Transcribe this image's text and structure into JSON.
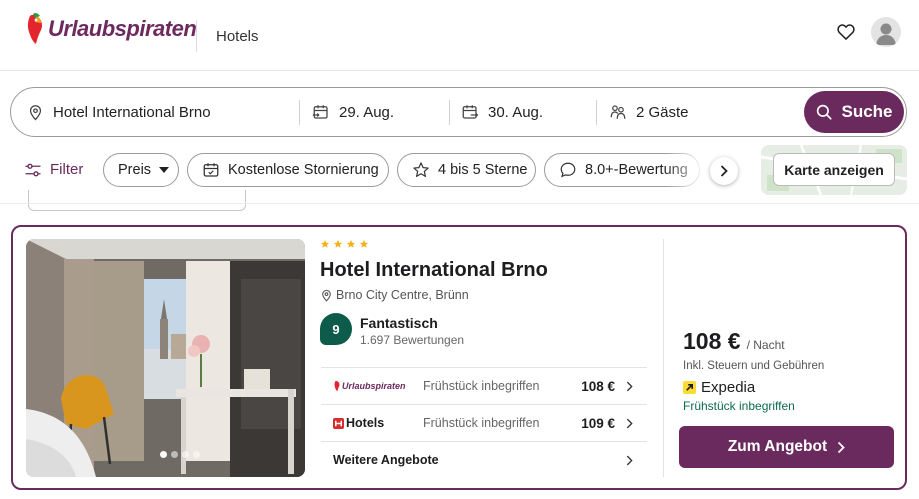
{
  "header": {
    "brand": "Urlaubspiraten",
    "section": "Hotels",
    "icons": [
      "favorites-heart-icon",
      "user-avatar-icon"
    ]
  },
  "search": {
    "destination": "Hotel International Brno",
    "checkin": "29. Aug.",
    "checkout": "30. Aug.",
    "guests": "2 Gäste",
    "button_label": "Suche"
  },
  "filters": {
    "filter_label": "Filter",
    "chips": [
      {
        "label": "Preis",
        "icon": "chevron-down-icon"
      },
      {
        "label": "Kostenlose Stornierung",
        "icon": "calendar-check-icon"
      },
      {
        "label": "4 bis 5 Sterne",
        "icon": "star-icon"
      },
      {
        "label": "8.0+-Bewertung",
        "icon": "chat-bubble-icon"
      }
    ],
    "map_button": "Karte anzeigen"
  },
  "hotel": {
    "stars": 4,
    "name": "Hotel International Brno",
    "location": "Brno City Centre, Brünn",
    "rating_score": "9",
    "rating_label": "Fantastisch",
    "review_count": "1.697 Bewertungen",
    "photo_index": 1,
    "photo_count": 4,
    "offers": [
      {
        "provider": "Urlaubspiraten",
        "label": "Frühstück inbegriffen",
        "price": "108 €"
      },
      {
        "provider": "Hotels",
        "label": "Frühstück inbegriffen",
        "price": "109 €"
      }
    ],
    "more_offers": "Weitere Angebote",
    "best_price": "108 €",
    "per_night": "/ Nacht",
    "taxes_note": "Inkl. Steuern und Gebühren",
    "best_provider": "Expedia",
    "best_inclusion": "Frühstück inbegriffen",
    "cta_label": "Zum Angebot"
  },
  "colors": {
    "brand": "#6b2a5d",
    "rating": "#0d5c4b",
    "inclusion_text": "#0d6b4f",
    "star": "#f5b21b"
  }
}
